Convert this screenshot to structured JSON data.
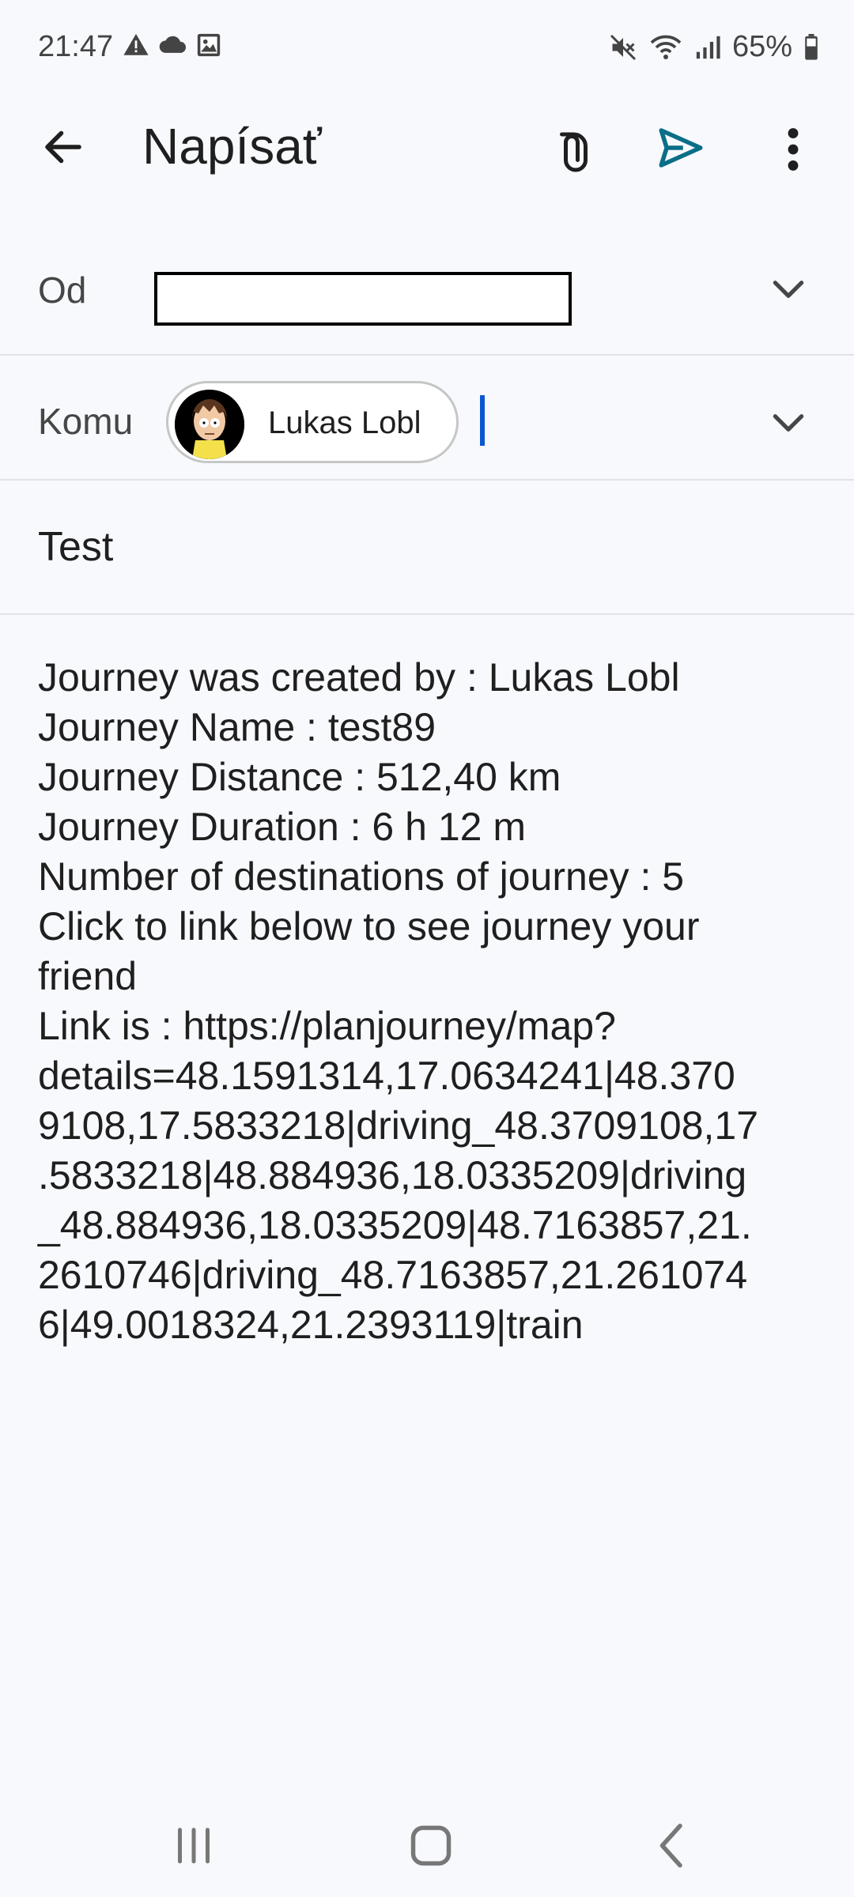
{
  "status_bar": {
    "time": "21:47",
    "battery": "65%",
    "icons_left": [
      "warning-icon",
      "cloud-icon",
      "image-icon"
    ],
    "icons_right": [
      "mute-icon",
      "wifi-icon",
      "signal-icon",
      "battery-icon"
    ]
  },
  "appbar": {
    "title": "Napísať"
  },
  "from": {
    "label": "Od",
    "value": ""
  },
  "to": {
    "label": "Komu",
    "recipient": "Lukas Lobl"
  },
  "subject": "Test",
  "body_lines": [
    "Journey was created by : Lukas Lobl",
    "Journey Name : test89",
    "Journey Distance : 512,40 km",
    "Journey Duration : 6 h 12 m",
    "Number of destinations of journey : 5",
    "Click to link below to see journey your",
    "friend",
    "Link is : https://planjourney/map?",
    "details=48.1591314,17.0634241|48.370",
    "9108,17.5833218|driving_48.3709108,17",
    ".5833218|48.884936,18.0335209|driving",
    "_48.884936,18.0335209|48.7163857,21.",
    "2610746|driving_48.7163857,21.261074",
    "6|49.0018324,21.2393119|train"
  ],
  "colors": {
    "accent_send": "#0B6E87",
    "cursor": "#0B57D0",
    "background": "#F8F9FD"
  }
}
